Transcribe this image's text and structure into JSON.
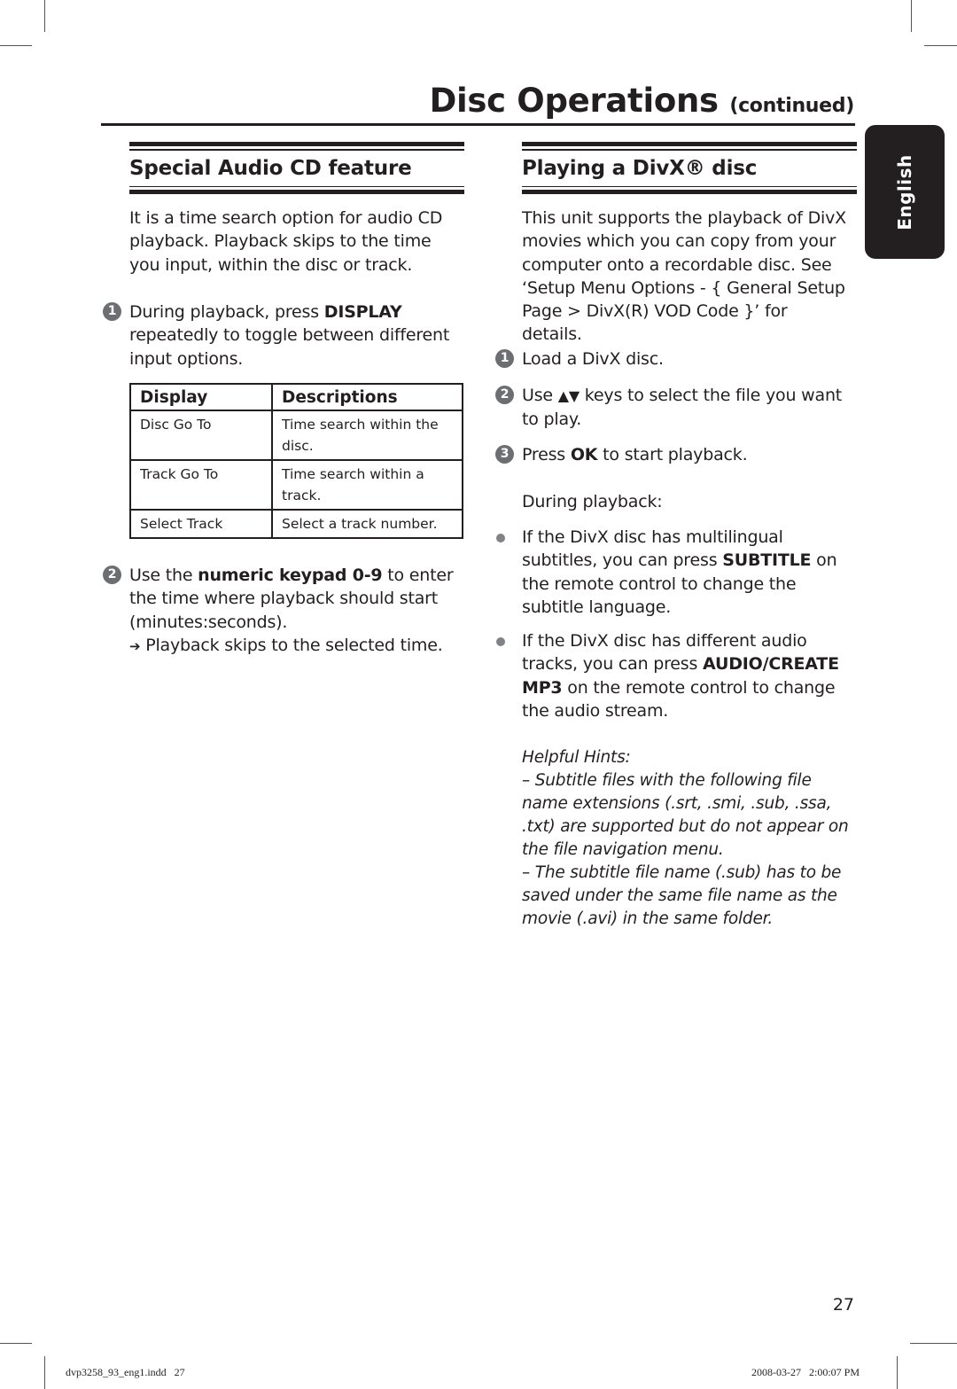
{
  "header": {
    "title": "Disc Operations",
    "title_suffix": "(continued)"
  },
  "language_tab": "English",
  "left_section": {
    "heading": "Special Audio CD feature",
    "intro": "It is a time search option for audio CD playback. Playback skips to the time you input, within the disc or track.",
    "steps": [
      {
        "number": "1",
        "pre": "During playback, press ",
        "bold": "DISPLAY",
        "post": " repeatedly to toggle between different input options."
      },
      {
        "number": "2",
        "pre": "Use the ",
        "bold": "numeric keypad 0-9",
        "post": " to enter the time where playback should start (minutes:seconds).",
        "result_arrow": "➔",
        "result": "Playback skips to the selected time."
      }
    ],
    "table": {
      "headers": [
        "Display",
        "Descriptions"
      ],
      "rows": [
        [
          "Disc Go To",
          "Time search within the disc."
        ],
        [
          "Track Go To",
          "Time search within a track."
        ],
        [
          "Select Track",
          "Select a track number."
        ]
      ]
    }
  },
  "right_section": {
    "heading": "Playing a DivX® disc",
    "intro": "This unit supports the playback of DivX movies which you can copy from your computer onto a recordable disc. See ‘Setup Menu Options - { General Setup Page > DivX(R) VOD Code }’ for details.",
    "steps": [
      {
        "number": "1",
        "text": "Load a DivX disc."
      },
      {
        "number": "2",
        "pre": "Use ",
        "keys": "▲▼",
        "post": " keys to select the file you want to play."
      },
      {
        "number": "3",
        "pre": "Press ",
        "bold": "OK",
        "post": " to start playback."
      }
    ],
    "during_label": "During playback:",
    "bullets": [
      {
        "pre": "If the DivX disc has multilingual subtitles, you can press ",
        "bold": "SUBTITLE",
        "post": " on the remote control to change the subtitle language."
      },
      {
        "pre": "If the DivX disc has different audio tracks, you can press ",
        "bold": "AUDIO/CREATE MP3",
        "post": " on the remote control to change the audio stream."
      }
    ],
    "hints": {
      "title": "Helpful Hints:",
      "items": [
        "–  Subtitle files with the following file name extensions (.srt, .smi, .sub, .ssa, .txt) are supported but do not appear on the file navigation menu.",
        "–  The subtitle file name (.sub) has to be saved under the same file name as the movie (.avi) in the same folder."
      ]
    }
  },
  "footer": {
    "page_number": "27",
    "slug_file": "dvp3258_93_eng1.indd   27",
    "slug_date": "2008-03-27   2:00:07 PM"
  }
}
